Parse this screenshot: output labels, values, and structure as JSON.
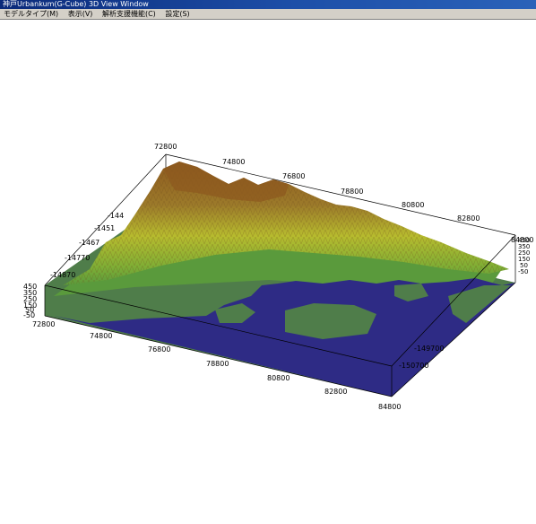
{
  "window": {
    "title": "神戸Urbankum(G-Cube)  3D View Window"
  },
  "menu": [
    {
      "label": "モデルタイプ(M)"
    },
    {
      "label": "表示(V)"
    },
    {
      "label": "解析支援機能(C)"
    },
    {
      "label": "設定(S)"
    }
  ],
  "axes": {
    "back_x_ticks": [
      "72800",
      "74800",
      "76800",
      "78800",
      "80800",
      "82800",
      "84800"
    ],
    "front_x_ticks": [
      "72800",
      "74800",
      "76800",
      "78800",
      "80800",
      "82800",
      "84800"
    ],
    "left_y_ticks": [
      "-144",
      "-1451",
      "-1467",
      "-14770",
      "-14870"
    ],
    "right_y_ticks": [
      "-149700",
      "-150700"
    ],
    "z_ticks_left": [
      "450",
      "350",
      "250",
      "150",
      "50",
      "-50"
    ],
    "z_ticks_right": [
      "450",
      "350",
      "250",
      "150",
      "50",
      "-50"
    ]
  },
  "colors": {
    "sea": "#2e2b85",
    "lowland": "#4f7d4a",
    "plain": "#5a9a3c",
    "hills": "#b7bb2e",
    "mountains": "#8e5a1f",
    "peaks": "#c07a4a"
  }
}
